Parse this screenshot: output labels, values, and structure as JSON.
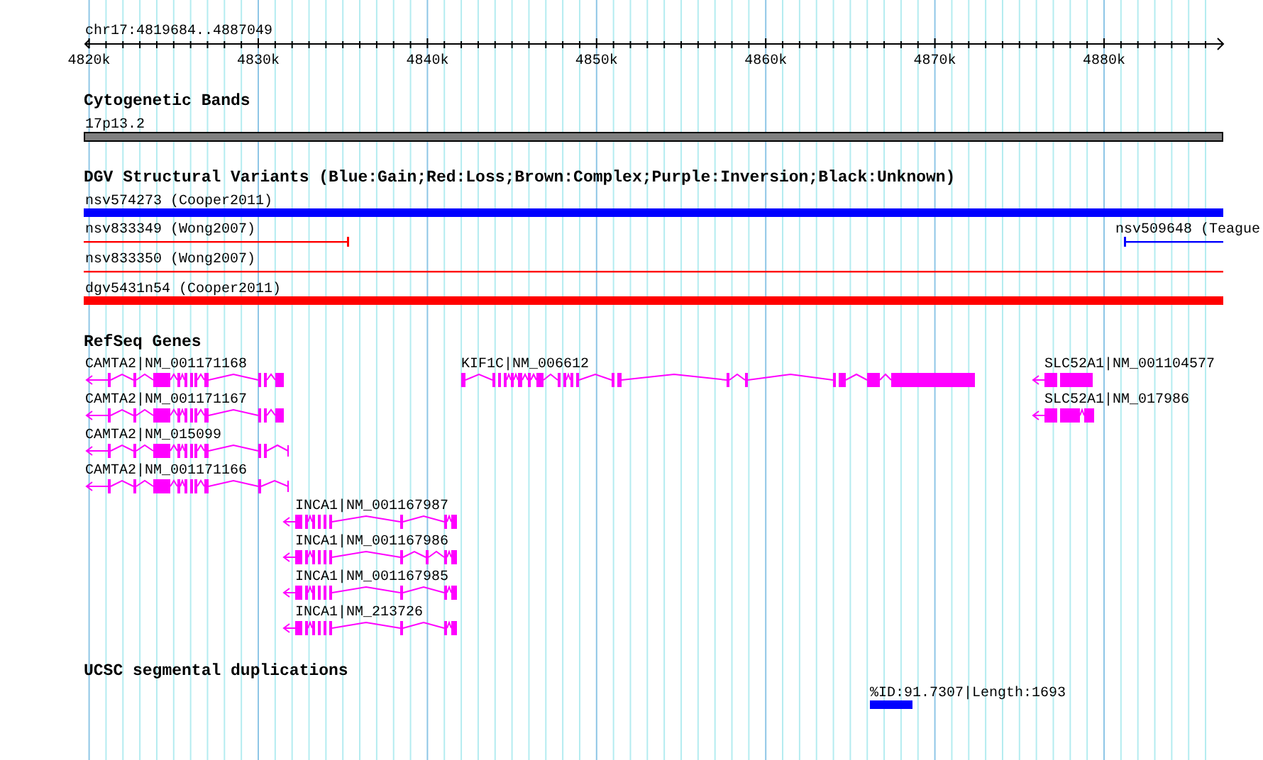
{
  "ruler": {
    "region": "chr17:4819684..4887049",
    "ticks": [
      "4820k",
      "4830k",
      "4840k",
      "4850k",
      "4860k",
      "4870k",
      "4880k"
    ]
  },
  "tracks": [
    {
      "kind": "cytoband",
      "title": "Cytogenetic Bands",
      "features": [
        {
          "label": "17p13.2"
        }
      ]
    },
    {
      "kind": "variants",
      "title": "DGV Structural Variants (Blue:Gain;Red:Loss;Brown:Complex;Purple:Inversion;Black:Unknown)",
      "features": [
        {
          "label": "nsv574273 (Cooper2011)",
          "kind": "thick",
          "color": "#0000ff"
        },
        {
          "label": "nsv833349 (Wong2007)",
          "kind": "thin",
          "color": "#ff0000"
        },
        {
          "label": "nsv509648 (Teague",
          "kind": "thin",
          "color": "#0000ff"
        },
        {
          "label": "nsv833350 (Wong2007)",
          "kind": "thin",
          "color": "#ff0000"
        },
        {
          "label": "dgv5431n54 (Cooper2011)",
          "kind": "thick",
          "color": "#ff0000"
        }
      ]
    },
    {
      "kind": "genes",
      "title": "RefSeq Genes",
      "features": [
        {
          "label": "CAMTA2|NM_001171168"
        },
        {
          "label": "KIF1C|NM_006612"
        },
        {
          "label": "SLC52A1|NM_001104577"
        },
        {
          "label": "CAMTA2|NM_001171167"
        },
        {
          "label": "SLC52A1|NM_017986"
        },
        {
          "label": "CAMTA2|NM_015099"
        },
        {
          "label": "CAMTA2|NM_001171166"
        },
        {
          "label": "INCA1|NM_001167987"
        },
        {
          "label": "INCA1|NM_001167986"
        },
        {
          "label": "INCA1|NM_001167985"
        },
        {
          "label": "INCA1|NM_213726"
        }
      ]
    },
    {
      "kind": "segdup",
      "title": "UCSC segmental duplications",
      "features": [
        {
          "label": "%ID:91.7307|Length:1693"
        }
      ]
    }
  ]
}
